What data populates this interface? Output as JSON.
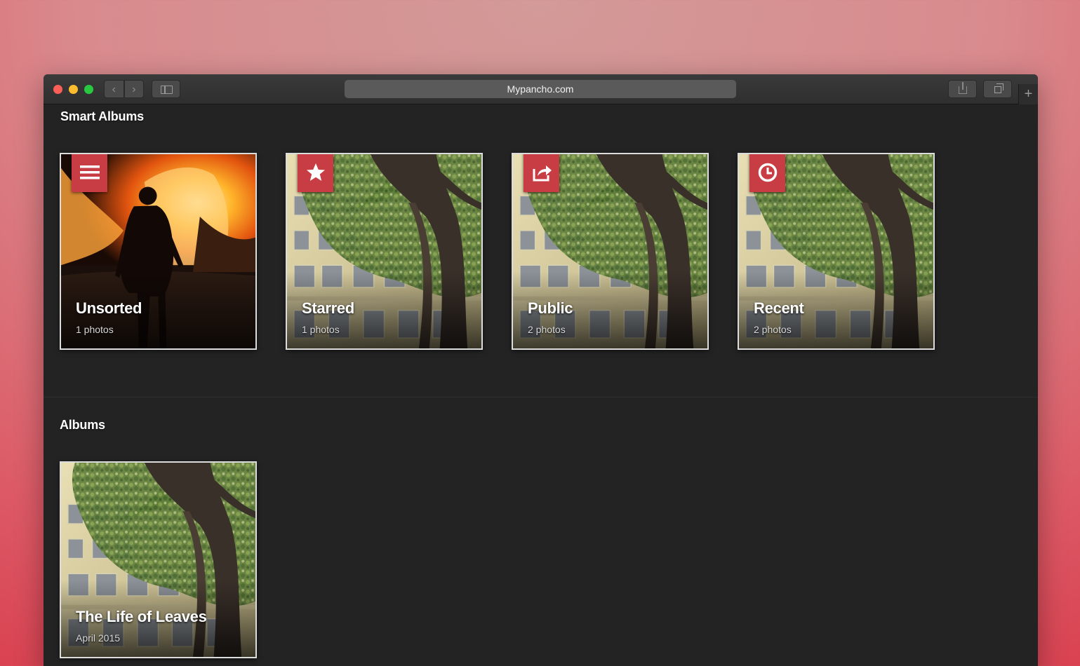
{
  "browser": {
    "url": "Mypancho.com",
    "back_icon": "chevron-left-icon",
    "forward_icon": "chevron-right-icon",
    "sidebar_icon": "sidebar-icon",
    "share_icon": "share-icon",
    "tabs_icon": "tabs-overview-icon",
    "new_tab_label": "+"
  },
  "smart_albums": {
    "heading": "Smart Albums",
    "items": [
      {
        "title": "Unsorted",
        "subtitle": "1 photos",
        "icon": "list-icon",
        "image": "bonfire-photo"
      },
      {
        "title": "Starred",
        "subtitle": "1 photos",
        "icon": "star-icon",
        "image": "tree-photo"
      },
      {
        "title": "Public",
        "subtitle": "2 photos",
        "icon": "share-icon",
        "image": "tree-photo"
      },
      {
        "title": "Recent",
        "subtitle": "2 photos",
        "icon": "clock-icon",
        "image": "tree-photo"
      }
    ]
  },
  "albums": {
    "heading": "Albums",
    "items": [
      {
        "title": "The Life of Leaves",
        "subtitle": "April 2015",
        "image": "tree-photo"
      }
    ]
  },
  "colors": {
    "badge": "#c83d43",
    "window_bg": "#232323",
    "card_border": "#dcdcdc"
  }
}
